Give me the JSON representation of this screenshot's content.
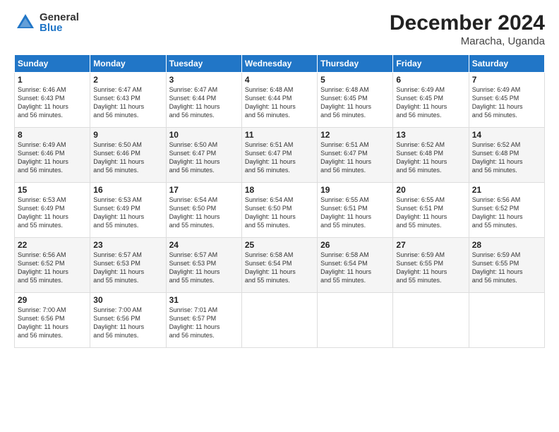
{
  "header": {
    "logo_general": "General",
    "logo_blue": "Blue",
    "title": "December 2024",
    "subtitle": "Maracha, Uganda"
  },
  "days_of_week": [
    "Sunday",
    "Monday",
    "Tuesday",
    "Wednesday",
    "Thursday",
    "Friday",
    "Saturday"
  ],
  "weeks": [
    [
      {
        "day": "1",
        "info": "Sunrise: 6:46 AM\nSunset: 6:43 PM\nDaylight: 11 hours\nand 56 minutes."
      },
      {
        "day": "2",
        "info": "Sunrise: 6:47 AM\nSunset: 6:43 PM\nDaylight: 11 hours\nand 56 minutes."
      },
      {
        "day": "3",
        "info": "Sunrise: 6:47 AM\nSunset: 6:44 PM\nDaylight: 11 hours\nand 56 minutes."
      },
      {
        "day": "4",
        "info": "Sunrise: 6:48 AM\nSunset: 6:44 PM\nDaylight: 11 hours\nand 56 minutes."
      },
      {
        "day": "5",
        "info": "Sunrise: 6:48 AM\nSunset: 6:45 PM\nDaylight: 11 hours\nand 56 minutes."
      },
      {
        "day": "6",
        "info": "Sunrise: 6:49 AM\nSunset: 6:45 PM\nDaylight: 11 hours\nand 56 minutes."
      },
      {
        "day": "7",
        "info": "Sunrise: 6:49 AM\nSunset: 6:45 PM\nDaylight: 11 hours\nand 56 minutes."
      }
    ],
    [
      {
        "day": "8",
        "info": "Sunrise: 6:49 AM\nSunset: 6:46 PM\nDaylight: 11 hours\nand 56 minutes."
      },
      {
        "day": "9",
        "info": "Sunrise: 6:50 AM\nSunset: 6:46 PM\nDaylight: 11 hours\nand 56 minutes."
      },
      {
        "day": "10",
        "info": "Sunrise: 6:50 AM\nSunset: 6:47 PM\nDaylight: 11 hours\nand 56 minutes."
      },
      {
        "day": "11",
        "info": "Sunrise: 6:51 AM\nSunset: 6:47 PM\nDaylight: 11 hours\nand 56 minutes."
      },
      {
        "day": "12",
        "info": "Sunrise: 6:51 AM\nSunset: 6:47 PM\nDaylight: 11 hours\nand 56 minutes."
      },
      {
        "day": "13",
        "info": "Sunrise: 6:52 AM\nSunset: 6:48 PM\nDaylight: 11 hours\nand 56 minutes."
      },
      {
        "day": "14",
        "info": "Sunrise: 6:52 AM\nSunset: 6:48 PM\nDaylight: 11 hours\nand 56 minutes."
      }
    ],
    [
      {
        "day": "15",
        "info": "Sunrise: 6:53 AM\nSunset: 6:49 PM\nDaylight: 11 hours\nand 55 minutes."
      },
      {
        "day": "16",
        "info": "Sunrise: 6:53 AM\nSunset: 6:49 PM\nDaylight: 11 hours\nand 55 minutes."
      },
      {
        "day": "17",
        "info": "Sunrise: 6:54 AM\nSunset: 6:50 PM\nDaylight: 11 hours\nand 55 minutes."
      },
      {
        "day": "18",
        "info": "Sunrise: 6:54 AM\nSunset: 6:50 PM\nDaylight: 11 hours\nand 55 minutes."
      },
      {
        "day": "19",
        "info": "Sunrise: 6:55 AM\nSunset: 6:51 PM\nDaylight: 11 hours\nand 55 minutes."
      },
      {
        "day": "20",
        "info": "Sunrise: 6:55 AM\nSunset: 6:51 PM\nDaylight: 11 hours\nand 55 minutes."
      },
      {
        "day": "21",
        "info": "Sunrise: 6:56 AM\nSunset: 6:52 PM\nDaylight: 11 hours\nand 55 minutes."
      }
    ],
    [
      {
        "day": "22",
        "info": "Sunrise: 6:56 AM\nSunset: 6:52 PM\nDaylight: 11 hours\nand 55 minutes."
      },
      {
        "day": "23",
        "info": "Sunrise: 6:57 AM\nSunset: 6:53 PM\nDaylight: 11 hours\nand 55 minutes."
      },
      {
        "day": "24",
        "info": "Sunrise: 6:57 AM\nSunset: 6:53 PM\nDaylight: 11 hours\nand 55 minutes."
      },
      {
        "day": "25",
        "info": "Sunrise: 6:58 AM\nSunset: 6:54 PM\nDaylight: 11 hours\nand 55 minutes."
      },
      {
        "day": "26",
        "info": "Sunrise: 6:58 AM\nSunset: 6:54 PM\nDaylight: 11 hours\nand 55 minutes."
      },
      {
        "day": "27",
        "info": "Sunrise: 6:59 AM\nSunset: 6:55 PM\nDaylight: 11 hours\nand 55 minutes."
      },
      {
        "day": "28",
        "info": "Sunrise: 6:59 AM\nSunset: 6:55 PM\nDaylight: 11 hours\nand 56 minutes."
      }
    ],
    [
      {
        "day": "29",
        "info": "Sunrise: 7:00 AM\nSunset: 6:56 PM\nDaylight: 11 hours\nand 56 minutes."
      },
      {
        "day": "30",
        "info": "Sunrise: 7:00 AM\nSunset: 6:56 PM\nDaylight: 11 hours\nand 56 minutes."
      },
      {
        "day": "31",
        "info": "Sunrise: 7:01 AM\nSunset: 6:57 PM\nDaylight: 11 hours\nand 56 minutes."
      },
      {
        "day": "",
        "info": ""
      },
      {
        "day": "",
        "info": ""
      },
      {
        "day": "",
        "info": ""
      },
      {
        "day": "",
        "info": ""
      }
    ]
  ]
}
